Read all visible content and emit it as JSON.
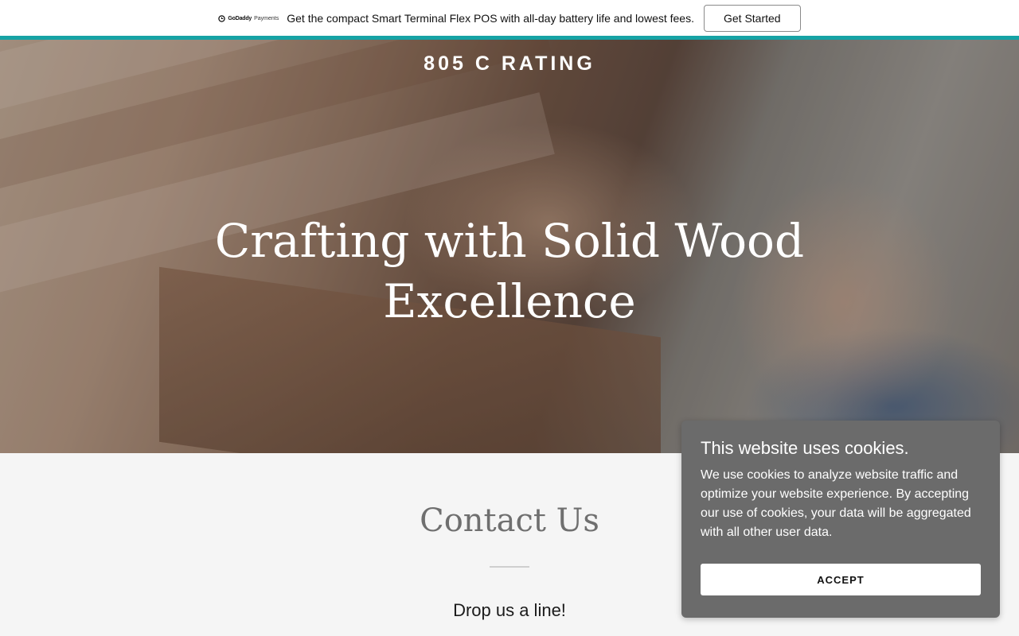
{
  "promo": {
    "logo_brand": "GoDaddy",
    "logo_sub": "Payments",
    "message": "Get the compact Smart Terminal Flex POS with all-day battery life and lowest fees.",
    "cta_label": "Get Started"
  },
  "hero": {
    "site_title": "805 C RATING",
    "heading": "Crafting with Solid Wood Excellence"
  },
  "contact": {
    "title": "Contact Us",
    "subtitle": "Drop us a line!"
  },
  "cookie_banner": {
    "title": "This website uses cookies.",
    "body": "We use cookies to analyze website traffic and optimize your website experience. By accepting our use of cookies, your data will be aggregated with all other user data.",
    "accept_label": "ACCEPT"
  },
  "colors": {
    "accent_teal": "#16a3a5",
    "cookie_bg": "#6b6b6b",
    "section_bg": "#f5f5f5"
  }
}
